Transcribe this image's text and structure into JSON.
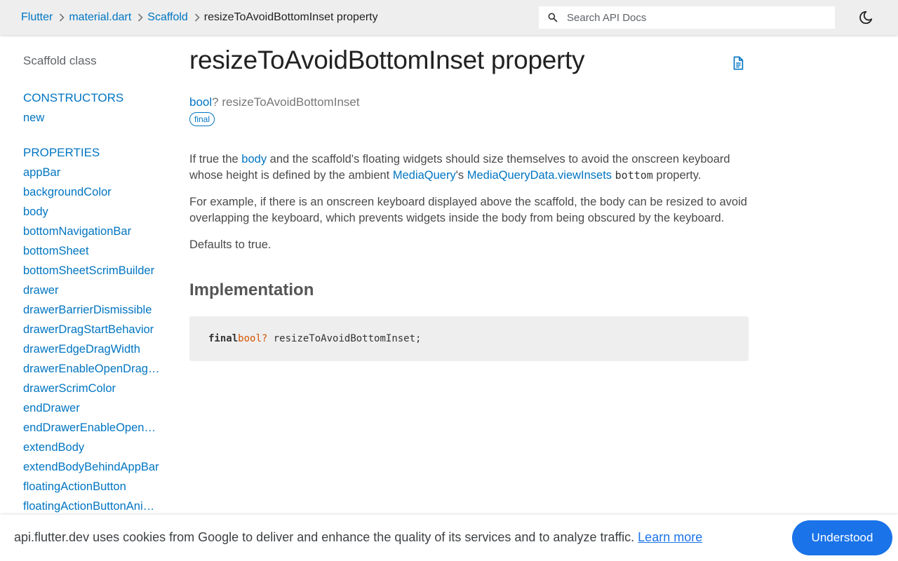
{
  "header": {
    "breadcrumbs": [
      {
        "label": "Flutter",
        "link": true
      },
      {
        "label": "material.dart",
        "link": true
      },
      {
        "label": "Scaffold",
        "link": true
      },
      {
        "label": "resizeToAvoidBottomInset property",
        "link": false
      }
    ],
    "search": {
      "placeholder": "Search API Docs",
      "value": ""
    },
    "icons": {
      "search": "search-icon",
      "theme": "dark-mode-moon-icon"
    }
  },
  "sidebar": {
    "title": "Scaffold class",
    "sections": [
      {
        "label": "CONSTRUCTORS",
        "items": [
          "new"
        ]
      },
      {
        "label": "PROPERTIES",
        "items": [
          "appBar",
          "backgroundColor",
          "body",
          "bottomNavigationBar",
          "bottomSheet",
          "bottomSheetScrimBuilder",
          "drawer",
          "drawerBarrierDismissible",
          "drawerDragStartBehavior",
          "drawerEdgeDragWidth",
          "drawerEnableOpenDragGesture",
          "drawerScrimColor",
          "endDrawer",
          "endDrawerEnableOpenDragGesture",
          "extendBody",
          "extendBodyBehindAppBar",
          "floatingActionButton",
          "floatingActionButtonAnimator"
        ]
      }
    ]
  },
  "main": {
    "title": "resizeToAvoidBottomInset property",
    "signature": {
      "type": "bool",
      "nullable": "?",
      "name": "resizeToAvoidBottomInset",
      "badge": "final"
    },
    "description": {
      "p1": {
        "t1": "If true the ",
        "l1": "body",
        "t2": " and the scaffold's floating widgets should size themselves to avoid the onscreen keyboard whose height is defined by the ambient ",
        "l2": "MediaQuery",
        "t3": "'s ",
        "l3": "MediaQueryData.viewInsets",
        "t4": " ",
        "code": "bottom",
        "t5": " property."
      },
      "p2": "For example, if there is an onscreen keyboard displayed above the scaffold, the body can be resized to avoid overlapping the keyboard, which prevents widgets inside the body from being obscured by the keyboard.",
      "p3": "Defaults to true."
    },
    "implementation_title": "Implementation",
    "code": {
      "keyword": "final",
      "type": "bool?",
      "rest": " resizeToAvoidBottomInset;"
    }
  },
  "cookie_bar": {
    "text": "api.flutter.dev uses cookies from Google to deliver and enhance the quality of its services and to analyze traffic. ",
    "link": "Learn more",
    "button": "Understood"
  },
  "colors": {
    "link": "#0175c2",
    "button": "#1a73e8",
    "header_bg": "#eeeeee",
    "code_type": "#d35400"
  }
}
